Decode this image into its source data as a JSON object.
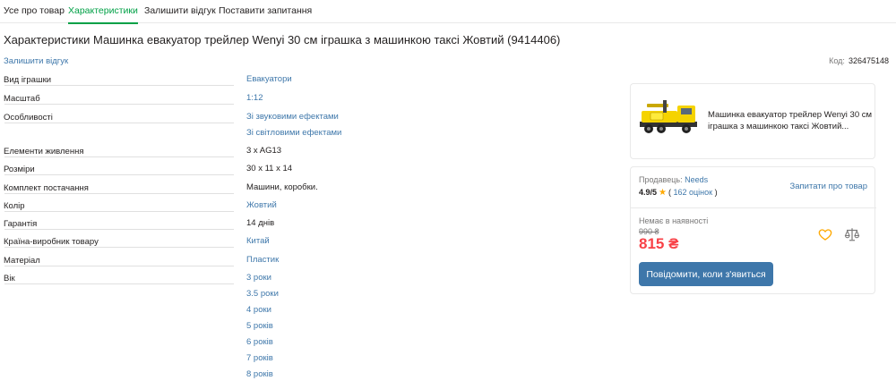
{
  "tabs": [
    {
      "label": "Усе про товар"
    },
    {
      "label": "Характеристики"
    },
    {
      "label": "Залишити відгук"
    },
    {
      "label": "Поставити запитання"
    }
  ],
  "page_title": "Характеристики Машинка евакуатор трейлер Wenyi 30 см іграшка з машинкою таксі Жовтий (9414406)",
  "review_link": "Залишити відгук",
  "code": {
    "label": "Код:",
    "value": "326475148"
  },
  "specs": [
    {
      "name": "Вид іграшки",
      "values": [
        {
          "text": "Евакуатори",
          "link": true
        }
      ]
    },
    {
      "name": "Масштаб",
      "values": [
        {
          "text": "1:12",
          "link": true
        }
      ]
    },
    {
      "name": "Особливості",
      "values": [
        {
          "text": "Зі звуковими ефектами",
          "link": true
        },
        {
          "text": "Зі світловими ефектами",
          "link": true
        }
      ]
    },
    {
      "name": "Елементи живлення",
      "values": [
        {
          "text": "3 x AG13",
          "link": false
        }
      ]
    },
    {
      "name": "Розміри",
      "values": [
        {
          "text": "30 x 11 x 14",
          "link": false
        }
      ]
    },
    {
      "name": "Комплект постачання",
      "values": [
        {
          "text": "Машини, коробки.",
          "link": false
        }
      ]
    },
    {
      "name": "Колір",
      "values": [
        {
          "text": "Жовтий",
          "link": true
        }
      ]
    },
    {
      "name": "Гарантія",
      "values": [
        {
          "text": "14 днів",
          "link": false
        }
      ]
    },
    {
      "name": "Країна-виробник товару",
      "values": [
        {
          "text": "Китай",
          "link": true
        }
      ]
    },
    {
      "name": "Матеріал",
      "values": [
        {
          "text": "Пластик",
          "link": true
        }
      ]
    },
    {
      "name": "Вік",
      "values": [
        {
          "text": "3 роки",
          "link": true
        },
        {
          "text": "3.5 роки",
          "link": true
        },
        {
          "text": "4 роки",
          "link": true
        },
        {
          "text": "5 років",
          "link": true
        },
        {
          "text": "6 років",
          "link": true
        },
        {
          "text": "7 років",
          "link": true
        },
        {
          "text": "8 років",
          "link": true
        }
      ]
    }
  ],
  "product_card": {
    "title": "Машинка евакуатор трейлер Wenyi 30 см іграшка з машинкою таксі Жовтий..."
  },
  "seller": {
    "label": "Продавець:",
    "name": "Needs",
    "rating": "4.9/5",
    "reviews": "162 оцінок",
    "ask": "Запитати про товар"
  },
  "availability": {
    "status": "Немає в наявності",
    "old_price": "990 ₴",
    "price": "815 ₴",
    "notify_button": "Повідомити, коли з'явиться"
  },
  "colors": {
    "accent": "#00a046",
    "link": "#3e77aa",
    "price": "#f84147",
    "star": "#ffa900"
  }
}
